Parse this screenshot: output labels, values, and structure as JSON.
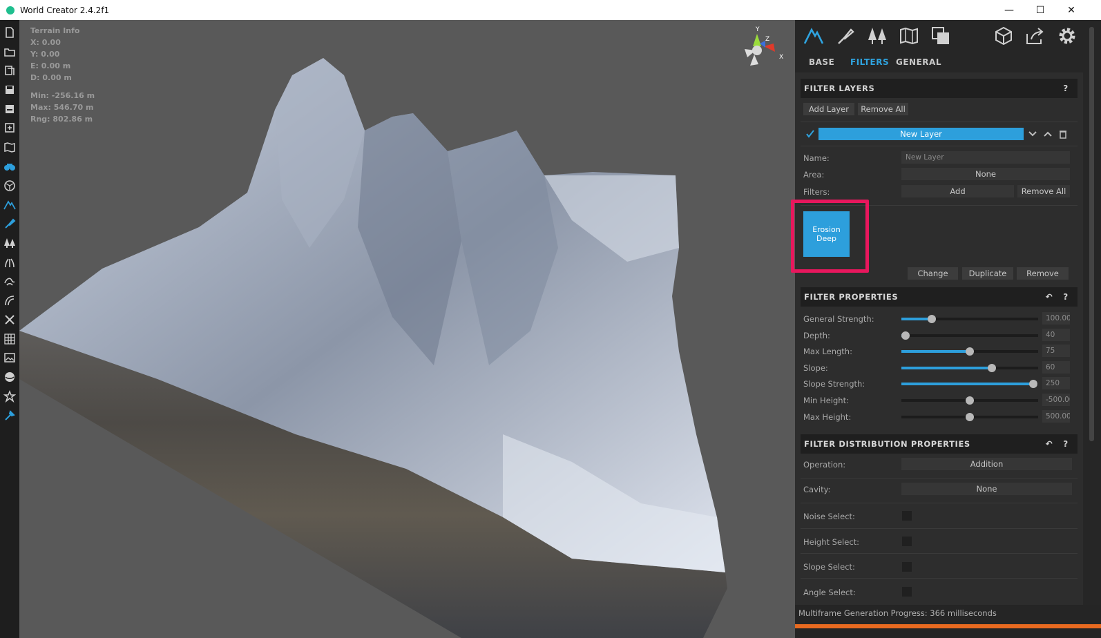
{
  "window": {
    "title": "World Creator 2.4.2f1",
    "minimize_glyph": "—",
    "maximize_glyph": "☐",
    "close_glyph": "✕"
  },
  "toolbar": {
    "icons": [
      "new-file-icon",
      "open-folder-icon",
      "open-project-icon",
      "save-icon",
      "save-as-icon",
      "import-icon",
      "map-icon",
      "binoculars-icon",
      "globe-icon",
      "terrain-icon",
      "brush-icon",
      "trees-icon",
      "grass-icon",
      "water-icon",
      "roads-icon",
      "tools-icon",
      "grid-icon",
      "image-icon",
      "sphere-icon",
      "star-icon",
      "pipette-icon"
    ]
  },
  "viewport": {
    "terrain_info": {
      "title": "Terrain Info",
      "x": "X: 0.00",
      "y": "Y: 0.00",
      "e": "E: 0.00 m",
      "d": "D: 0.00 m",
      "min": "Min: -256.16 m",
      "max": "Max: 546.70 m",
      "rng": "Rng: 802.86 m"
    },
    "gizmo": {
      "y": "Y",
      "z": "Z",
      "x": "X"
    }
  },
  "panel": {
    "top_icons": [
      "terrain-mode-icon",
      "brush-mode-icon",
      "trees-mode-icon",
      "map-mode-icon",
      "layers-mode-icon",
      "export-3d-icon",
      "share-icon",
      "settings-icon"
    ],
    "tabs": [
      {
        "label": "BASE",
        "active": false
      },
      {
        "label": "FILTERS",
        "active": true
      },
      {
        "label": "GENERAL",
        "active": false
      }
    ],
    "filter_layers": {
      "header": "FILTER LAYERS",
      "help": "?",
      "add_layer": "Add Layer",
      "remove_all": "Remove All",
      "layer_name": "New Layer",
      "name_label": "Name:",
      "name_value": "New Layer",
      "area_label": "Area:",
      "area_value": "None",
      "filters_label": "Filters:",
      "filters_add": "Add",
      "filters_remove_all": "Remove All",
      "filter_tile": "Erosion Deep",
      "change": "Change",
      "duplicate": "Duplicate",
      "remove": "Remove"
    },
    "filter_properties": {
      "header": "FILTER PROPERTIES",
      "help": "?",
      "rows": [
        {
          "label": "General Strength:",
          "value": "100.00",
          "fraction": 0.22,
          "filled": true
        },
        {
          "label": "Depth:",
          "value": "40",
          "fraction": 0.03,
          "filled": true
        },
        {
          "label": "Max Length:",
          "value": "75",
          "fraction": 0.5,
          "filled": true
        },
        {
          "label": "Slope:",
          "value": "60",
          "fraction": 0.66,
          "filled": true
        },
        {
          "label": "Slope Strength:",
          "value": "250",
          "fraction": 0.965,
          "filled": true
        },
        {
          "label": "Min Height:",
          "value": "-500.00",
          "fraction": 0.5,
          "filled": false
        },
        {
          "label": "Max Height:",
          "value": "500.00",
          "fraction": 0.5,
          "filled": false
        }
      ]
    },
    "distribution": {
      "header": "FILTER DISTRIBUTION PROPERTIES",
      "help": "?",
      "operation_label": "Operation:",
      "operation_value": "Addition",
      "cavity_label": "Cavity:",
      "cavity_value": "None",
      "noise_label": "Noise Select:",
      "height_label": "Height Select:",
      "slope_label": "Slope Select:",
      "angle_label": "Angle Select:"
    },
    "status": {
      "text": "Multiframe Generation Progress: 366 milliseconds",
      "progress": 1.0
    }
  },
  "colors": {
    "accent": "#2d9fdc",
    "highlight": "#e8175d",
    "progress": "#e86a20"
  }
}
